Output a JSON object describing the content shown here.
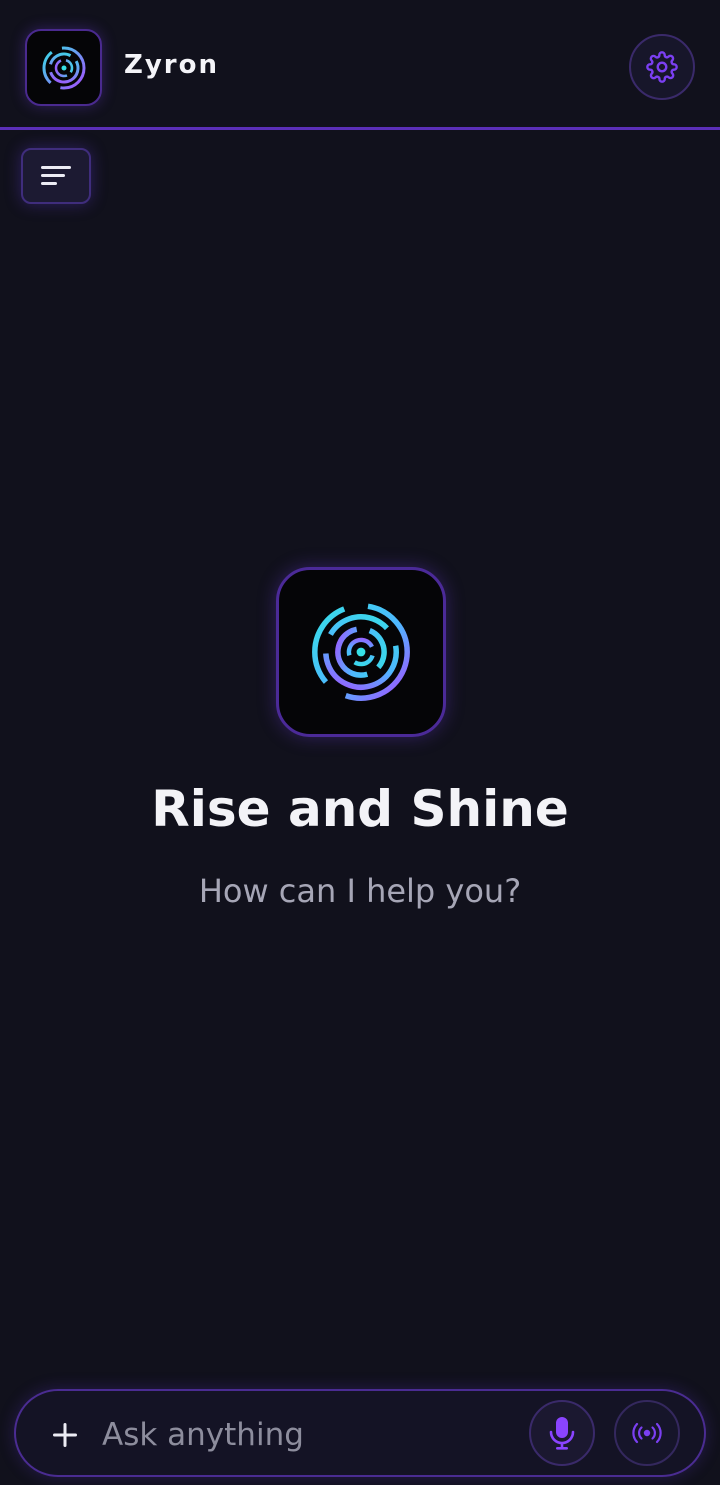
{
  "header": {
    "title": "Zyron",
    "logo_icon": "spiral-logo-icon",
    "settings_icon": "gear-icon"
  },
  "sidebar_toggle": {
    "icon": "menu-lines-icon"
  },
  "hero": {
    "logo_icon": "spiral-logo-icon",
    "title": "Rise and Shine",
    "subtitle": "How can I help you?"
  },
  "composer": {
    "placeholder": "Ask anything",
    "value": "",
    "add_icon": "plus-icon",
    "mic_icon": "microphone-icon",
    "voice_icon": "broadcast-icon"
  },
  "colors": {
    "background": "#11111c",
    "accent": "#7b3ff2",
    "header_divider": "#5b2fb8",
    "logo_cyan": "#36e0e6",
    "logo_purple": "#a64dff"
  }
}
